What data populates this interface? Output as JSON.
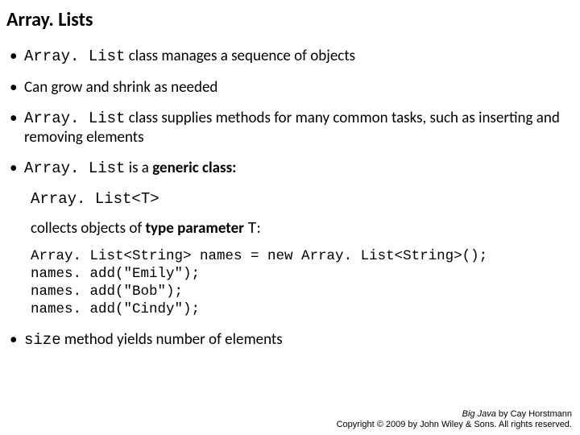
{
  "title": "Array. Lists",
  "bullets": {
    "b1_code": "Array. List",
    "b1_rest": " class manages a sequence of objects",
    "b2": "Can grow and shrink as needed",
    "b3_code": "Array. List",
    "b3_rest": " class supplies methods for many common tasks, such as inserting and removing elements",
    "b4_code": "Array. List",
    "b4_mid": " is a ",
    "b4_bold": "generic class:"
  },
  "generic_example": "Array. List<T>",
  "collects_pre": "collects objects of ",
  "collects_bold": "type parameter",
  "collects_space": " ",
  "collects_t": "T",
  "collects_colon": ":",
  "code": "Array. List<String> names = new Array. List<String>();\nnames. add(\"Emily\");\nnames. add(\"Bob\");\nnames. add(\"Cindy\");",
  "b5_code": "size",
  "b5_rest": " method yields number of elements",
  "footer": {
    "line1_ital": "Big Java",
    "line1_rest": " by Cay Horstmann",
    "line2": "Copyright © 2009 by John Wiley & Sons. All rights reserved."
  }
}
